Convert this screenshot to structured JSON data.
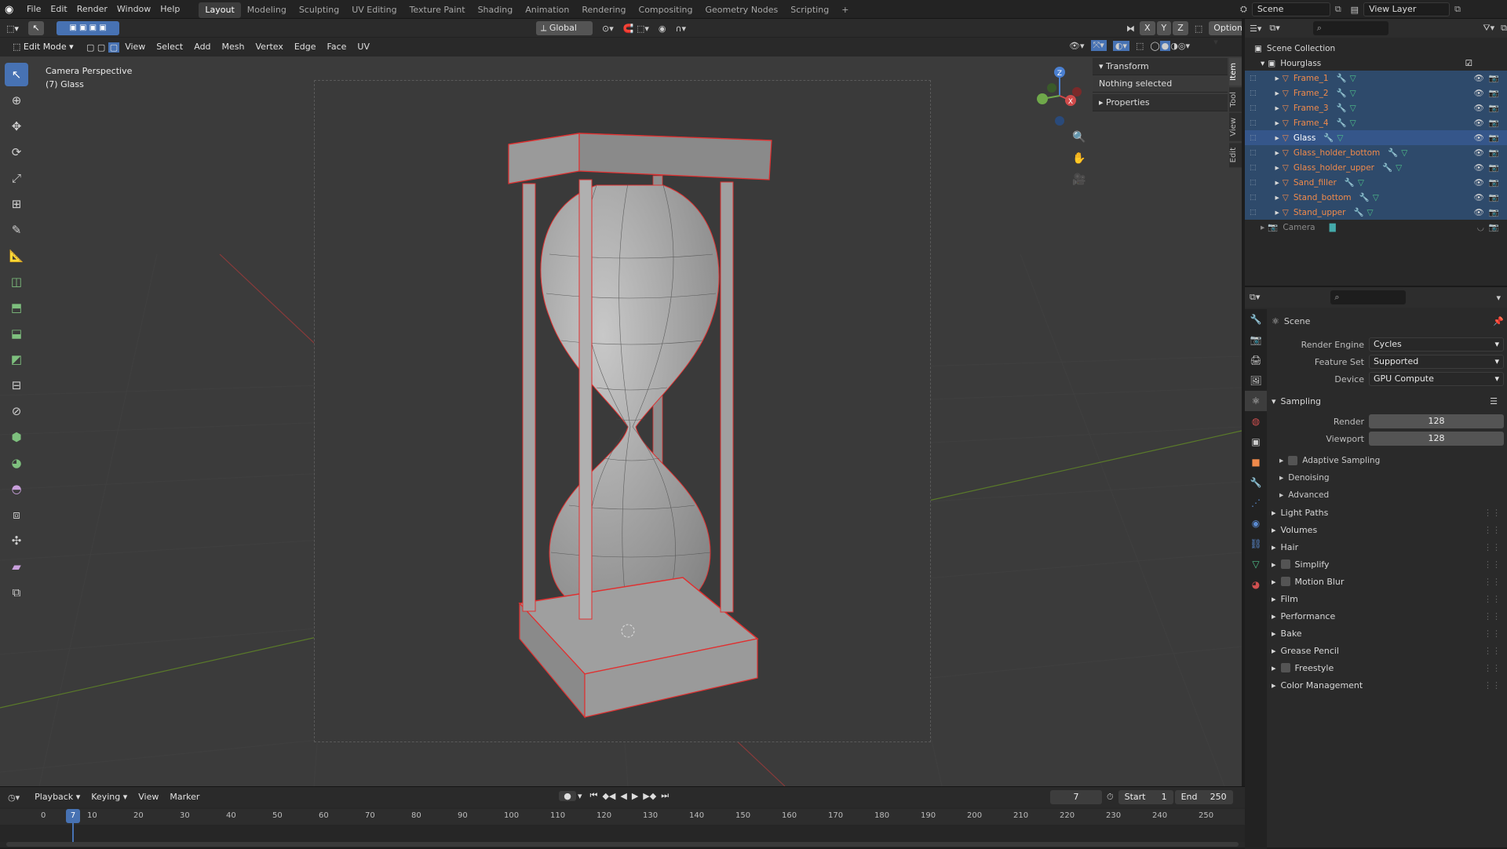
{
  "topbar": {
    "menus": [
      "File",
      "Edit",
      "Render",
      "Window",
      "Help"
    ],
    "workspaces": [
      "Layout",
      "Modeling",
      "Sculpting",
      "UV Editing",
      "Texture Paint",
      "Shading",
      "Animation",
      "Rendering",
      "Compositing",
      "Geometry Nodes",
      "Scripting"
    ],
    "active_workspace": "Layout",
    "add_tab": "+",
    "scene": "Scene",
    "view_layer": "View Layer"
  },
  "viewport": {
    "mode": "Edit Mode",
    "menus": [
      "View",
      "Select",
      "Add",
      "Mesh",
      "Vertex",
      "Edge",
      "Face",
      "UV"
    ],
    "orientation": "Global",
    "options": "Options",
    "axes": [
      "X",
      "Y",
      "Z"
    ],
    "overlay_line1": "Camera Perspective",
    "overlay_line2": "(7) Glass",
    "gizmo": {
      "x": "X",
      "y": "Y",
      "z": "Z"
    },
    "npanel": {
      "transform": "Transform",
      "nothing_selected": "Nothing selected",
      "properties": "Properties",
      "tabs": [
        "Item",
        "Tool",
        "View",
        "Edit"
      ]
    }
  },
  "outliner": {
    "root": "Scene Collection",
    "collection": "Hourglass",
    "objects": [
      "Frame_1",
      "Frame_2",
      "Frame_3",
      "Frame_4",
      "Glass",
      "Glass_holder_bottom",
      "Glass_holder_upper",
      "Sand_filler",
      "Stand_bottom",
      "Stand_upper"
    ],
    "active": "Glass",
    "camera": "Camera"
  },
  "properties": {
    "title": "Scene",
    "render_engine_label": "Render Engine",
    "render_engine": "Cycles",
    "feature_set_label": "Feature Set",
    "feature_set": "Supported",
    "device_label": "Device",
    "device": "GPU Compute",
    "sampling": "Sampling",
    "render_label": "Render",
    "render_samples": "128",
    "viewport_label": "Viewport",
    "viewport_samples": "128",
    "subs": [
      "Adaptive Sampling",
      "Denoising",
      "Advanced"
    ],
    "sections": [
      "Light Paths",
      "Volumes",
      "Hair",
      "Simplify",
      "Motion Blur",
      "Film",
      "Performance",
      "Bake",
      "Grease Pencil",
      "Freestyle",
      "Color Management"
    ]
  },
  "timeline": {
    "menus": [
      "Playback",
      "Keying",
      "View",
      "Marker"
    ],
    "current_frame": "7",
    "start_label": "Start",
    "start": "1",
    "end_label": "End",
    "end": "250",
    "ticks": [
      "0",
      "10",
      "20",
      "30",
      "40",
      "50",
      "60",
      "70",
      "80",
      "90",
      "100",
      "110",
      "120",
      "130",
      "140",
      "150",
      "160",
      "170",
      "180",
      "190",
      "200",
      "210",
      "220",
      "230",
      "240",
      "250"
    ]
  },
  "colors": {
    "accent": "#4772b3",
    "selected_object": "#f08a4b",
    "edit_edge": "#e03030"
  }
}
